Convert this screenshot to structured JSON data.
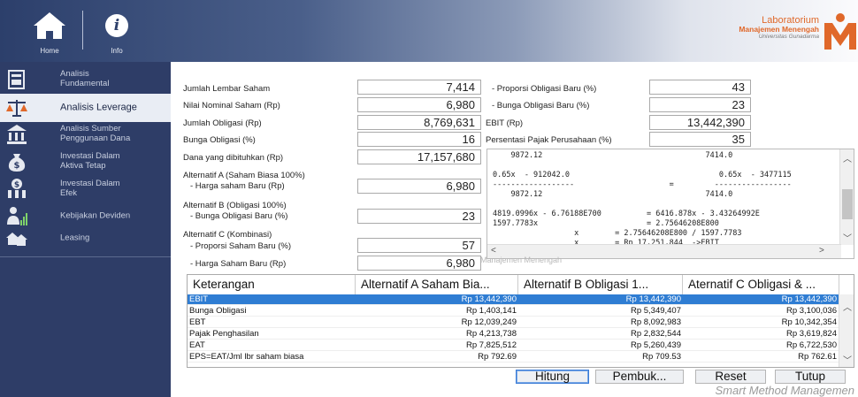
{
  "header": {
    "home_label": "Home",
    "info_label": "Info",
    "lab_line1": "Laboratorium",
    "lab_line2": "Manajemen Menengah",
    "lab_line3": "Universitas Gunadarma"
  },
  "sidebar": {
    "items": [
      {
        "label": "Analisis\nFundamental",
        "icon": "newspaper-icon"
      },
      {
        "label": "Analisis Leverage",
        "icon": "balance-scale-icon"
      },
      {
        "label": "Analisis Sumber\nPenggunaan Dana",
        "icon": "bank-icon"
      },
      {
        "label": "Investasi Dalam\nAktiva Tetap",
        "icon": "money-bag-icon"
      },
      {
        "label": "Investasi Dalam\nEfek",
        "icon": "building-dollar-icon"
      },
      {
        "label": "Kebijakan Deviden",
        "icon": "person-chart-icon"
      },
      {
        "label": "Leasing",
        "icon": "houses-icon"
      }
    ]
  },
  "form": {
    "jumlah_lembar_saham": {
      "label": "Jumlah Lembar Saham",
      "value": "7,414"
    },
    "nilai_nominal_saham": {
      "label": "Nilai Nominal Saham (Rp)",
      "value": "6,980"
    },
    "jumlah_obligasi": {
      "label": "Jumlah Obligasi (Rp)",
      "value": "8,769,631"
    },
    "bunga_obligasi": {
      "label": "Bunga Obligasi (%)",
      "value": "16"
    },
    "dana_dibutuhkan": {
      "label": "Dana yang dibituhkan (Rp)",
      "value": "17,157,680"
    },
    "alt_a_label": "Alternatif A (Saham Biasa 100%)",
    "alt_a_harga": {
      "label": "- Harga saham Baru (Rp)",
      "value": "6,980"
    },
    "alt_b_label": "Alternatif B (Obligasi 100%)",
    "alt_b_bunga": {
      "label": "- Bunga Obligasi Baru (%)",
      "value": "23"
    },
    "alt_c_label": "Alternatif C (Kombinasi)",
    "alt_c_proporsi_saham": {
      "label": "- Proporsi Saham Baru (%)",
      "value": "57"
    },
    "alt_c_harga_saham": {
      "label": "- Harga Saham Baru (Rp)",
      "value": "6,980"
    },
    "proporsi_obligasi": {
      "label": "- Proporsi Obligasi Baru (%)",
      "value": "43"
    },
    "bunga_obligasi_baru": {
      "label": "- Bunga Obligasi Baru (%)",
      "value": "23"
    },
    "ebit": {
      "label": "EBIT (Rp)",
      "value": "13,442,390"
    },
    "pajak": {
      "label": "Persentasi Pajak Perusahaan (%)",
      "value": "35"
    }
  },
  "calc_text": "    9872.12                                    7414.0\n\n0.65x  - 912042.0                                 0.65x  - 3477115\n------------------                     =         -----------------\n    9872.12                                    7414.0\n\n4819.0996x - 6.76188E700          = 6416.878x - 3.43264992E\n1597.7783x                        = 2.75646208E800\n                  x        = 2.75646208E800 / 1597.7783\n                  x        = Rp 17,251,844  ->EBIT",
  "watermark": "Manajemen Menengah",
  "table": {
    "headers": [
      "Keterangan",
      "Alternatif A Saham Bia...",
      "Alternatif B Obligasi 1...",
      "Aternatif C Obligasi & ..."
    ],
    "rows": [
      [
        "EBIT",
        "Rp 13,442,390",
        "Rp 13,442,390",
        "Rp 13,442,390"
      ],
      [
        "Bunga Obligasi",
        "Rp 1,403,141",
        "Rp 5,349,407",
        "Rp 3,100,036"
      ],
      [
        "EBT",
        "Rp 12,039,249",
        "Rp 8,092,983",
        "Rp 10,342,354"
      ],
      [
        "Pajak Penghasilan",
        "Rp 4,213,738",
        "Rp 2,832,544",
        "Rp 3,619,824"
      ],
      [
        "EAT",
        "Rp 7,825,512",
        "Rp 5,260,439",
        "Rp 6,722,530"
      ],
      [
        "EPS=EAT/Jml lbr saham biasa",
        "Rp 792.69",
        "Rp 709.53",
        "Rp 762.61"
      ]
    ]
  },
  "buttons": {
    "hitung": "Hitung",
    "pembuktian": "Pembuk...",
    "reset": "Reset",
    "tutup": "Tutup"
  },
  "tagline": "Smart Method Managemen",
  "colors": {
    "sidebar": "#2e3d67",
    "selected_row": "#2f7dd3",
    "accent": "#e0682a"
  }
}
